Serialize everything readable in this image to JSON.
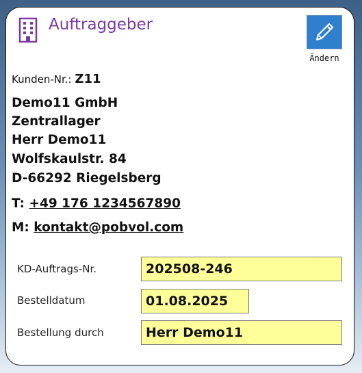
{
  "card": {
    "title": "Auftraggeber",
    "edit_label": "Ändern"
  },
  "customer": {
    "number_label": "Kunden-Nr.:",
    "number": "Z11",
    "address": [
      "Demo11 GmbH",
      "Zentrallager",
      "Herr Demo11",
      "Wolfskaulstr. 84",
      "D-66292 Riegelsberg"
    ],
    "phone_label": "T:",
    "phone": "+49 176 1234567890",
    "email_label": "M:",
    "email": "kontakt@pobvol.com"
  },
  "fields": [
    {
      "label": "KD-Auftrags-Nr.",
      "value": "202508-246"
    },
    {
      "label": "Bestelldatum",
      "value": "01.08.2025"
    },
    {
      "label": "Bestellung durch",
      "value": "Herr Demo11"
    }
  ],
  "colors": {
    "title": "#7a3aa4",
    "edit_button": "#2f7fcf",
    "field_bg": "#ffff99"
  },
  "icons": {
    "header": "building-icon",
    "edit": "pencil-icon"
  }
}
